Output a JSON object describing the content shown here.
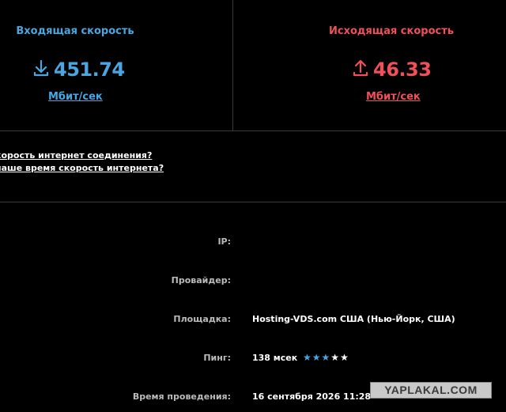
{
  "download": {
    "title": "Входящая скорость",
    "value": "451.74",
    "unit": "Мбит/сек",
    "icon": "download-arrow-icon",
    "color": "#4aa6e0"
  },
  "upload": {
    "title": "Исходящая скорость",
    "value": "46.33",
    "unit": "Мбит/сек",
    "icon": "upload-arrow-icon",
    "color": "#f0505a"
  },
  "faq": {
    "link1": "корость интернет соединения?",
    "link2": "наше время скорость интернета?"
  },
  "info": {
    "ip_label": "IP:",
    "provider_label": "Провайдер:",
    "site_label": "Площадка:",
    "site_value": "Hosting-VDS.com США (Нью-Йорк, США)",
    "ping_label": "Пинг:",
    "ping_value": "138 мсек",
    "ping_rating_of_5": 3,
    "time_label": "Время проведения:",
    "time_value": "16 сентября 2026 11:28"
  },
  "watermark": "YAPLAKAL.COM"
}
